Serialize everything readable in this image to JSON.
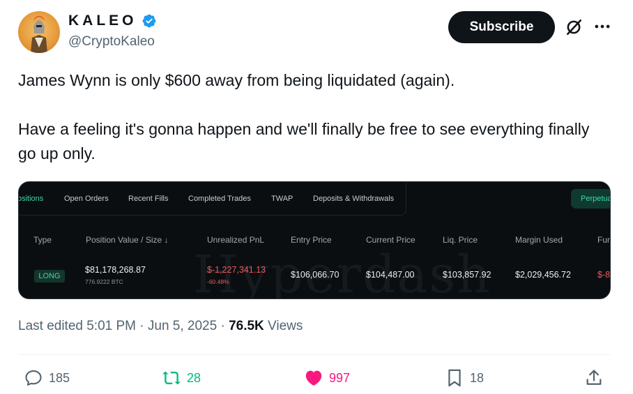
{
  "author": {
    "display_name": "KALEO",
    "handle": "@CryptoKaleo",
    "verified": true
  },
  "header": {
    "subscribe_label": "Subscribe",
    "grok_icon": "grok-icon",
    "more_icon": "more-icon"
  },
  "tweet": {
    "line1": "James Wynn is only $600 away from being liquidated (again).",
    "line2": "Have a feeling it's gonna happen and we'll finally be free to see everything finally go up only."
  },
  "media": {
    "tabs": [
      {
        "label": "ositions"
      },
      {
        "label": "Open Orders"
      },
      {
        "label": "Recent Fills"
      },
      {
        "label": "Completed Trades"
      },
      {
        "label": "TWAP"
      },
      {
        "label": "Deposits & Withdrawals"
      }
    ],
    "perp_label": "Perpetua",
    "columns": [
      "Type",
      "Position Value / Size ↓",
      "Unrealized PnL",
      "Entry Price",
      "Current Price",
      "Liq. Price",
      "Margin Used",
      "Fun"
    ],
    "row": {
      "type": "LONG",
      "position_value": "$81,178,268.87",
      "position_size": "776.9222 BTC",
      "unrealized_pnl": "$-1,227,341.13",
      "unrealized_pct": "-60.48%",
      "entry_price": "$106,066.70",
      "current_price": "$104,487.00",
      "liq_price": "$103,857.92",
      "margin_used": "$2,029,456.72",
      "funding": "$-8"
    },
    "watermark": "Hyperdash",
    "colors": {
      "accent_green": "#3fd7a9",
      "negative_red": "#ef5a5a"
    }
  },
  "meta": {
    "edited": "Last edited 5:01 PM · Jun 5, 2025 · ",
    "views_count": "76.5K",
    "views_label": " Views"
  },
  "actions": {
    "replies": "185",
    "reposts": "28",
    "likes": "997",
    "bookmarks": "18"
  },
  "colors": {
    "repost": "#00ba7c",
    "like": "#f91880",
    "verified": "#1d9bf0"
  }
}
